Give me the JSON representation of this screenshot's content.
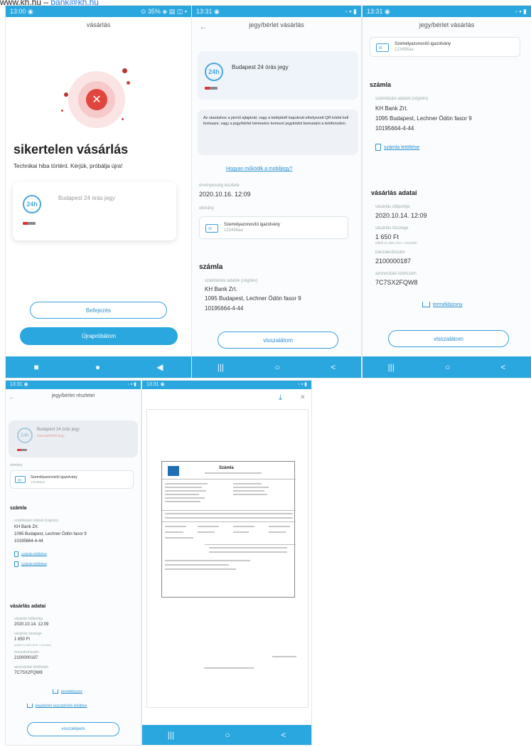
{
  "header_line": {
    "site": "www.kh.hu",
    "separator": " – ",
    "email": "bank@kh.hu"
  },
  "screen1": {
    "status_left": "13:00 ◉",
    "status_right": "⊙ 35% ◈ ▤ ◫ ▪",
    "title": "vásárlás",
    "headline": "sikertelen vásárlás",
    "message": "Technikai hiba történt. Kérjük, próbálja újra!",
    "ticket_badge": "24h",
    "ticket_name": "Budapest 24 órás jegy",
    "btn_home": "Befejezés",
    "btn_retry": "Újrapróbálom",
    "nav": [
      "■",
      "●",
      "◀"
    ]
  },
  "screen2": {
    "status_left": "13:31 ◉",
    "status_right": "◦ ▪ ▮",
    "title": "jegy/bérlet vásárlás",
    "back": "←",
    "ticket_badge": "24h",
    "ticket_name": "Budapest 24 órás jegy",
    "notice": "Az utazáshoz a jármű ajtajánál, vagy a beléptető kapuknál elhelyezett QR kódot kell leolvasni, vagy a jegy/bérlet kérésekor kemosó jegykódot bemutatni a telefonodon.",
    "help_link": "Hogyan működik a mobiljegy?",
    "validity_label": "érvényesség kezdete",
    "validity_value": "2020.10.16. 12:09",
    "document_label": "okmány",
    "document_name": "Személyazonosító igazolvány",
    "document_sub": "123456aa",
    "section_invoice": "számla",
    "issuer_label": "számlázási adatok (cégnév)",
    "issuer_name": "KH Bank Zrt.",
    "issuer_address": "1095 Budapest, Lechner Ödön fasor 9",
    "issuer_tax": "10195664-4-44",
    "btn_back": "visszalátom",
    "nav": [
      "|||",
      "○",
      "<"
    ]
  },
  "screen3": {
    "status_left": "13:31 ◉",
    "status_right": "◦ ▪ ▮",
    "title": "jegy/bérlet vásárlás",
    "document_name": "Személyazonosító igazolvány",
    "document_sub": "123456aa",
    "section_invoice": "számla",
    "issuer_label": "számlázási adatok (cégnév)",
    "issuer_name": "KH Bank Zrt.",
    "issuer_address": "1095 Budapest, Lechner Ödön fasor 9",
    "issuer_tax": "10195664-4-44",
    "invoice_link": "számla letöltése",
    "section_purchase": "vásárlás adatai",
    "purchase_time_label": "vásárlás időpontja",
    "purchase_time": "2020.10.14. 12:09",
    "amount_label": "vásárlás összege",
    "amount": "1 650 Ft",
    "amount_note": "ebből 21,46% ÁFA + kezelési",
    "txn_label": "tranzakciószám",
    "txn": "2100000187",
    "auth_label": "azonosítási kód/szám",
    "auth": "7C7SX2FQW8",
    "receipt_link": "termékbizony",
    "btn_back": "visszalátom",
    "nav": [
      "|||",
      "○",
      "<"
    ]
  },
  "screen4": {
    "status_left": "13:31 ◉",
    "status_right": "◦ ▪ ▮",
    "title": "jegy/bérlet részletei",
    "ticket_badge": "24h",
    "ticket_name": "Budapest 24 órás jegy",
    "ticket_status": "visszatérített jegy",
    "document_label": "okmány",
    "document_name": "Személyazonosító igazolvány",
    "document_sub": "123456aa",
    "section_invoice": "számla",
    "issuer_label": "számlázási adatok (cégnév)",
    "issuer_name": "KH Bank Zrt.",
    "issuer_address": "1095 Budapest, Lechner Ödön fasor 9",
    "issuer_tax": "10195664-4-44",
    "invoice_link": "számla letöltése",
    "credit_link": "számla letöltése",
    "section_purchase": "vásárlás adatai",
    "purchase_time_label": "vásárlás időpontja",
    "purchase_time": "2020.10.14. 12:09",
    "amount_label": "vásárlás összege",
    "amount": "1 650 Ft",
    "amount_note": "ebből 21,46% ÁFA + kezelési",
    "txn_label": "tranzakciószám",
    "txn": "2100000187",
    "auth_label": "azonosítási kód/szám",
    "auth": "7C7SX2FQW8",
    "receipt_link": "termékbizony",
    "refund_link": "jegy/bérlet visszatérítés letöltése",
    "btn_back": "visszalépem"
  },
  "screen5": {
    "status_left": "13:31 ◉",
    "status_right": "◦ ▪ ▮",
    "download_icon": "⤓",
    "close_icon": "✕",
    "doc_title": "Számla",
    "nav": [
      "|||",
      "○",
      "<"
    ]
  }
}
